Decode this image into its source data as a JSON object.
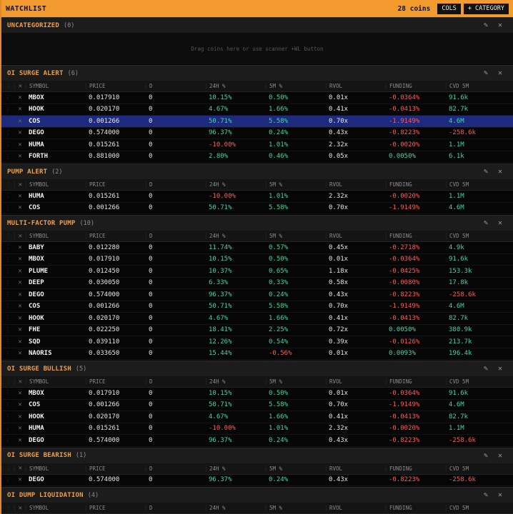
{
  "header": {
    "title": "WATCHLIST",
    "coin_count": "28 coins",
    "cols_label": "COLS",
    "add_category_label": "+ CATEGORY"
  },
  "columns": [
    "SYMBOL",
    "PRICE",
    "D",
    "24H %",
    "5M %",
    "RVOL",
    "FUNDING",
    "CVD 5M"
  ],
  "uncategorized": {
    "title": "UNCATEGORIZED",
    "count": "(0)",
    "empty_text": "Drag coins here or use scanner +WL button"
  },
  "sections": [
    {
      "title": "OI SURGE ALERT",
      "count": "(6)",
      "rows": [
        {
          "symbol": "MBOX",
          "price": "0.017910",
          "d": "0",
          "h24": "10.15%",
          "m5": "0.50%",
          "rvol": "0.01x",
          "funding": "-0.0364%",
          "cvd": "91.6k"
        },
        {
          "symbol": "HOOK",
          "price": "0.020170",
          "d": "0",
          "h24": "4.67%",
          "m5": "1.66%",
          "rvol": "0.41x",
          "funding": "-0.0413%",
          "cvd": "82.7k"
        },
        {
          "symbol": "COS",
          "price": "0.001266",
          "d": "0",
          "h24": "50.71%",
          "m5": "5.58%",
          "rvol": "0.70x",
          "funding": "-1.9149%",
          "cvd": "4.6M",
          "selected": true
        },
        {
          "symbol": "DEGO",
          "price": "0.574000",
          "d": "0",
          "h24": "96.37%",
          "m5": "0.24%",
          "rvol": "0.43x",
          "funding": "-0.8223%",
          "cvd": "-258.6k"
        },
        {
          "symbol": "HUMA",
          "price": "0.015261",
          "d": "0",
          "h24": "-10.00%",
          "m5": "1.01%",
          "rvol": "2.32x",
          "funding": "-0.0020%",
          "cvd": "1.1M"
        },
        {
          "symbol": "FORTH",
          "price": "0.881000",
          "d": "0",
          "h24": "2.80%",
          "m5": "0.46%",
          "rvol": "0.05x",
          "funding": "0.0050%",
          "cvd": "6.1k"
        }
      ]
    },
    {
      "title": "PUMP ALERT",
      "count": "(2)",
      "rows": [
        {
          "symbol": "HUMA",
          "price": "0.015261",
          "d": "0",
          "h24": "-10.00%",
          "m5": "1.01%",
          "rvol": "2.32x",
          "funding": "-0.0020%",
          "cvd": "1.1M"
        },
        {
          "symbol": "COS",
          "price": "0.001266",
          "d": "0",
          "h24": "50.71%",
          "m5": "5.58%",
          "rvol": "0.70x",
          "funding": "-1.9149%",
          "cvd": "4.6M"
        }
      ]
    },
    {
      "title": "MULTI-FACTOR PUMP",
      "count": "(10)",
      "rows": [
        {
          "symbol": "BABY",
          "price": "0.012280",
          "d": "0",
          "h24": "11.74%",
          "m5": "0.57%",
          "rvol": "0.45x",
          "funding": "-0.2718%",
          "cvd": "4.9k"
        },
        {
          "symbol": "MBOX",
          "price": "0.017910",
          "d": "0",
          "h24": "10.15%",
          "m5": "0.50%",
          "rvol": "0.01x",
          "funding": "-0.0364%",
          "cvd": "91.6k"
        },
        {
          "symbol": "PLUME",
          "price": "0.012450",
          "d": "0",
          "h24": "10.37%",
          "m5": "0.65%",
          "rvol": "1.18x",
          "funding": "-0.0425%",
          "cvd": "153.3k"
        },
        {
          "symbol": "DEEP",
          "price": "0.030050",
          "d": "0",
          "h24": "6.33%",
          "m5": "0.33%",
          "rvol": "0.58x",
          "funding": "-0.0080%",
          "cvd": "17.8k"
        },
        {
          "symbol": "DEGO",
          "price": "0.574000",
          "d": "0",
          "h24": "96.37%",
          "m5": "0.24%",
          "rvol": "0.43x",
          "funding": "-0.8223%",
          "cvd": "-258.6k"
        },
        {
          "symbol": "COS",
          "price": "0.001266",
          "d": "0",
          "h24": "50.71%",
          "m5": "5.58%",
          "rvol": "0.70x",
          "funding": "-1.9149%",
          "cvd": "4.6M"
        },
        {
          "symbol": "HOOK",
          "price": "0.020170",
          "d": "0",
          "h24": "4.67%",
          "m5": "1.66%",
          "rvol": "0.41x",
          "funding": "-0.0413%",
          "cvd": "82.7k"
        },
        {
          "symbol": "FHE",
          "price": "0.022250",
          "d": "0",
          "h24": "18.41%",
          "m5": "2.25%",
          "rvol": "0.72x",
          "funding": "0.0050%",
          "cvd": "380.9k"
        },
        {
          "symbol": "SQD",
          "price": "0.039110",
          "d": "0",
          "h24": "12.26%",
          "m5": "0.54%",
          "rvol": "0.39x",
          "funding": "-0.0126%",
          "cvd": "213.7k"
        },
        {
          "symbol": "NAORIS",
          "price": "0.033650",
          "d": "0",
          "h24": "15.44%",
          "m5": "-0.56%",
          "rvol": "0.01x",
          "funding": "0.0093%",
          "cvd": "196.4k"
        }
      ]
    },
    {
      "title": "OI SURGE BULLISH",
      "count": "(5)",
      "rows": [
        {
          "symbol": "MBOX",
          "price": "0.017910",
          "d": "0",
          "h24": "10.15%",
          "m5": "0.50%",
          "rvol": "0.01x",
          "funding": "-0.0364%",
          "cvd": "91.6k"
        },
        {
          "symbol": "COS",
          "price": "0.001266",
          "d": "0",
          "h24": "50.71%",
          "m5": "5.58%",
          "rvol": "0.70x",
          "funding": "-1.9149%",
          "cvd": "4.6M"
        },
        {
          "symbol": "HOOK",
          "price": "0.020170",
          "d": "0",
          "h24": "4.67%",
          "m5": "1.66%",
          "rvol": "0.41x",
          "funding": "-0.0413%",
          "cvd": "82.7k"
        },
        {
          "symbol": "HUMA",
          "price": "0.015261",
          "d": "0",
          "h24": "-10.00%",
          "m5": "1.01%",
          "rvol": "2.32x",
          "funding": "-0.0020%",
          "cvd": "1.1M"
        },
        {
          "symbol": "DEGO",
          "price": "0.574000",
          "d": "0",
          "h24": "96.37%",
          "m5": "0.24%",
          "rvol": "0.43x",
          "funding": "-0.8223%",
          "cvd": "-258.6k"
        }
      ]
    },
    {
      "title": "OI SURGE BEARISH",
      "count": "(1)",
      "rows": [
        {
          "symbol": "DEGO",
          "price": "0.574000",
          "d": "0",
          "h24": "96.37%",
          "m5": "0.24%",
          "rvol": "0.43x",
          "funding": "-0.8223%",
          "cvd": "-258.6k"
        }
      ]
    },
    {
      "title": "OI DUMP LIQUIDATION",
      "count": "(4)",
      "rows": []
    }
  ]
}
